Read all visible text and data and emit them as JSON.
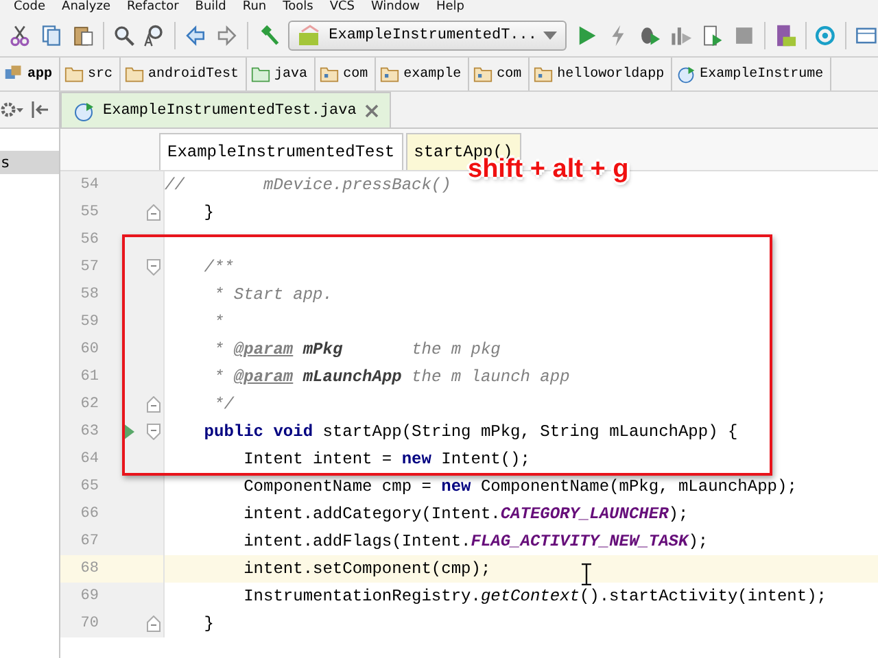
{
  "menu_bar": [
    "Code",
    "Analyze",
    "Refactor",
    "Build",
    "Run",
    "Tools",
    "VCS",
    "Window",
    "Help"
  ],
  "toolbar": {
    "run_config": "ExampleInstrumentedT..."
  },
  "breadcrumbs": [
    {
      "label": "app",
      "kind": "module"
    },
    {
      "label": "src",
      "kind": "folder"
    },
    {
      "label": "androidTest",
      "kind": "folder"
    },
    {
      "label": "java",
      "kind": "source"
    },
    {
      "label": "com",
      "kind": "package"
    },
    {
      "label": "example",
      "kind": "package"
    },
    {
      "label": "com",
      "kind": "package"
    },
    {
      "label": "helloworldapp",
      "kind": "package"
    },
    {
      "label": "ExampleInstrume",
      "kind": "class"
    }
  ],
  "left_panel": {
    "items": [
      {
        "label": "s",
        "selected": true
      }
    ]
  },
  "editor_tab": {
    "label": "ExampleInstrumentedTest.java"
  },
  "navigation": [
    {
      "label": "ExampleInstrumentedTest",
      "selected": false
    },
    {
      "label": "startApp()",
      "selected": true
    }
  ],
  "code_lines": [
    {
      "number": "54",
      "tokens": [
        {
          "text": "//        mDevice.pressBack()",
          "kind": "comment"
        }
      ]
    },
    {
      "number": "55",
      "fold_end": true,
      "tokens": [
        {
          "text": "    }",
          "kind": "plain"
        }
      ]
    },
    {
      "number": "56"
    },
    {
      "number": "57",
      "fold_start": true,
      "tokens": [
        {
          "text": "    /**",
          "kind": "comment"
        }
      ]
    },
    {
      "number": "58",
      "tokens": [
        {
          "text": "     * Start app.",
          "kind": "comment"
        }
      ]
    },
    {
      "number": "59",
      "tokens": [
        {
          "text": "     *",
          "kind": "comment"
        }
      ]
    },
    {
      "number": "60",
      "tokens": [
        {
          "text": "     * ",
          "kind": "comment"
        },
        {
          "text": "@param",
          "kind": "doctag"
        },
        {
          "text": " mPkg",
          "kind": "param"
        },
        {
          "text": "       the m pkg",
          "kind": "comment"
        }
      ]
    },
    {
      "number": "61",
      "tokens": [
        {
          "text": "     * ",
          "kind": "comment"
        },
        {
          "text": "@param",
          "kind": "doctag"
        },
        {
          "text": " mLaunchApp",
          "kind": "param"
        },
        {
          "text": " the m launch app",
          "kind": "comment"
        }
      ]
    },
    {
      "number": "62",
      "fold_end": true,
      "tokens": [
        {
          "text": "     */",
          "kind": "comment"
        }
      ]
    },
    {
      "number": "63",
      "fold_start": true,
      "run": true,
      "tokens": [
        {
          "text": "    public",
          "kind": "keyword"
        },
        {
          "text": " void",
          "kind": "keyword"
        },
        {
          "text": " startApp(String mPkg, String mLaunchApp) {",
          "kind": "plain"
        }
      ]
    },
    {
      "number": "64",
      "tokens": [
        {
          "text": "        Intent intent = ",
          "kind": "plain"
        },
        {
          "text": "new",
          "kind": "keyword"
        },
        {
          "text": " Intent();",
          "kind": "plain"
        }
      ]
    },
    {
      "number": "65",
      "tokens": [
        {
          "text": "        ComponentName cmp = ",
          "kind": "plain"
        },
        {
          "text": "new",
          "kind": "keyword"
        },
        {
          "text": " ComponentName(mPkg, mLaunchApp);",
          "kind": "plain"
        }
      ]
    },
    {
      "number": "66",
      "tokens": [
        {
          "text": "        intent.addCategory(Intent.",
          "kind": "plain"
        },
        {
          "text": "CATEGORY_LAUNCHER",
          "kind": "constant"
        },
        {
          "text": ");",
          "kind": "plain"
        }
      ]
    },
    {
      "number": "67",
      "tokens": [
        {
          "text": "        intent.addFlags(Intent.",
          "kind": "plain"
        },
        {
          "text": "FLAG_ACTIVITY_NEW_TASK",
          "kind": "constant"
        },
        {
          "text": ");",
          "kind": "plain"
        }
      ]
    },
    {
      "number": "68",
      "highlighted": true,
      "tokens": [
        {
          "text": "        intent.setComponent(cmp);",
          "kind": "plain"
        }
      ]
    },
    {
      "number": "69",
      "tokens": [
        {
          "text": "        InstrumentationRegistry.",
          "kind": "plain"
        },
        {
          "text": "getContext",
          "kind": "static"
        },
        {
          "text": "().startActivity(intent);",
          "kind": "plain"
        }
      ]
    },
    {
      "number": "70",
      "fold_end": true,
      "tokens": [
        {
          "text": "    }",
          "kind": "plain"
        }
      ]
    }
  ],
  "overlay_hint": "shift + alt + g"
}
